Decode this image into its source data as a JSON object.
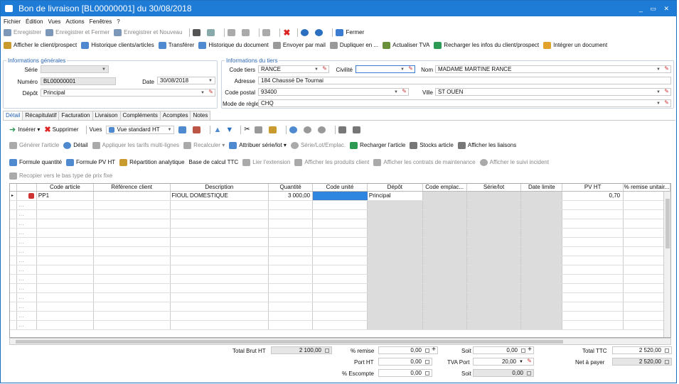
{
  "window": {
    "title": "Bon de livraison [BL00000001] du 30/08/2018",
    "controls": "_ ▭ ✕"
  },
  "menu": [
    "Fichier",
    "Édition",
    "Vues",
    "Actions",
    "Fenêtres",
    "?"
  ],
  "toolbar1": {
    "save": "Enregistrer",
    "save_close": "Enregistrer et Fermer",
    "save_new": "Enregistrer et Nouveau",
    "close": "Fermer"
  },
  "toolbar2": [
    "Afficher le client/prospect",
    "Historique clients/articles",
    "Transférer",
    "Historique du document",
    "Envoyer par mail",
    "Dupliquer en ...",
    "Actualiser TVA",
    "Recharger les infos du client/prospect",
    "Intégrer un document"
  ],
  "general": {
    "legend": "Informations générales",
    "serie_label": "Série",
    "numero_label": "Numéro",
    "numero": "BL00000001",
    "date_label": "Date",
    "date": "30/08/2018",
    "depot_label": "Dépôt",
    "depot": "Principal"
  },
  "tiers": {
    "legend": "Informations du tiers",
    "code_label": "Code tiers",
    "code": "RANCE",
    "civilite_label": "Civilité",
    "civilite": "",
    "nom_label": "Nom",
    "nom": "MADAME MARTINE RANCE",
    "adresse_label": "Adresse",
    "adresse": "184 Chaussé De Tournai",
    "cp_label": "Code postal",
    "cp": "93400",
    "ville_label": "Ville",
    "ville": "ST OUEN",
    "reglement_label": "Mode de règlement",
    "reglement": "CHQ"
  },
  "tabs": [
    "Détail",
    "Récapitulatif",
    "Facturation",
    "Livraison",
    "Compléments",
    "Acomptes",
    "Notes"
  ],
  "detail_toolbar1": {
    "insert": "Insérer",
    "delete": "Supprimer",
    "vues": "Vues",
    "vue": "Vue standard HT"
  },
  "detail_toolbar2": [
    "Générer l'article",
    "Détail",
    "Appliquer les tarifs multi-lignes",
    "Recalculer",
    "Attribuer série/lot",
    "Série/Lot/Emplac.",
    "Recharger l'article",
    "Stocks article",
    "Afficher les liaisons"
  ],
  "detail_toolbar3": [
    "Formule quantité",
    "Formule PV HT",
    "Répartition analytique",
    "Base de calcul TTC",
    "Lier l'extension",
    "Afficher les produits client",
    "Afficher les contrats de maintenance",
    "Afficher le suivi incident"
  ],
  "detail_toolbar4": "Recopier vers le bas type de prix fixe",
  "grid": {
    "columns": [
      "Code article",
      "Référence client",
      "Description",
      "Quantité",
      "Code unité",
      "Dépôt",
      "Code emplac...",
      "Série/lot",
      "Date limite",
      "PV HT",
      "% remise unitair..."
    ],
    "rows": [
      [
        "PP1",
        "",
        "FIOUL DOMESTIQUE",
        "3 000,00",
        "",
        "Principal",
        "",
        "",
        "",
        "0,70",
        ""
      ]
    ]
  },
  "totals": {
    "brut_label": "Total Brut HT",
    "brut": "2 100,00",
    "remise_label": "% remise",
    "remise": "0,00",
    "port_label": "Port HT",
    "port": "0,00",
    "escompte_label": "% Escompte",
    "escompte": "0,00",
    "soit_label": "Soit",
    "soit1": "0,00",
    "soit2": "0,00",
    "tva_port_label": "TVA Port",
    "tva_port": "20,00",
    "ttc_label": "Total TTC",
    "ttc": "2 520,00",
    "net_label": "Net à payer",
    "net": "2 520,00"
  }
}
